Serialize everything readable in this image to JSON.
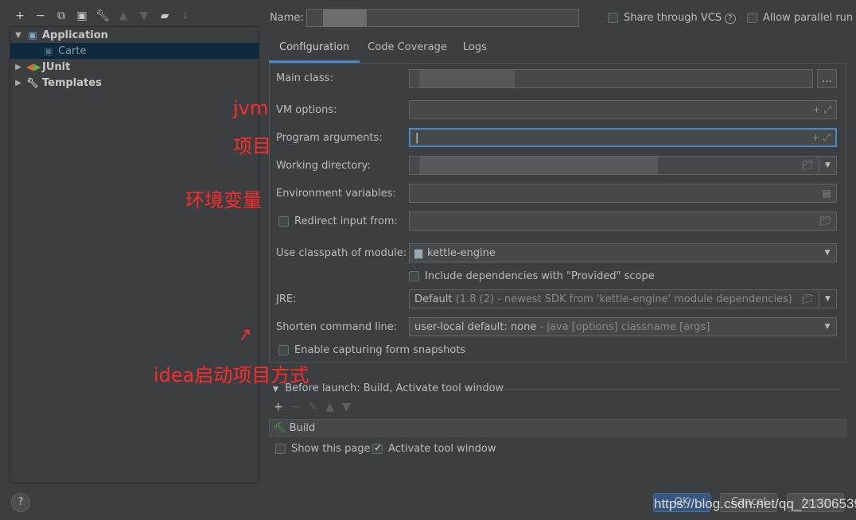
{
  "toolbar": {
    "icons": [
      "plus-icon",
      "minus-icon",
      "copy-icon",
      "save-icon",
      "wrench-icon",
      "arrow-up-icon",
      "arrow-down-icon",
      "folder-add-icon",
      "sort-icon"
    ]
  },
  "tree": {
    "items": [
      {
        "label": "Application",
        "expanded": true
      },
      {
        "label": "Carte",
        "selected": true
      },
      {
        "label": "JUnit"
      },
      {
        "label": "Templates"
      }
    ]
  },
  "header": {
    "name_label": "Name:",
    "name_value": "",
    "share_vcs": "Share through VCS",
    "parallel": "Allow parallel run"
  },
  "tabs": [
    {
      "label": "Configuration",
      "active": true
    },
    {
      "label": "Code Coverage"
    },
    {
      "label": "Logs"
    }
  ],
  "form": {
    "main_class": "Main class:",
    "vm_options": "VM options:",
    "program_args": "Program arguments:",
    "working_dir": "Working directory:",
    "env_vars": "Environment variables:",
    "redirect": "Redirect input from:",
    "classpath": "Use classpath of module:",
    "classpath_value": "kettle-engine",
    "include_deps": "Include dependencies with \"Provided\" scope",
    "jre": "JRE:",
    "jre_value": "Default",
    "jre_hint": "(1.8 (2) - newest SDK from 'kettle-engine' module dependencies)",
    "shorten": "Shorten command line:",
    "shorten_value": "user-local default: none",
    "shorten_hint": "- java [options] classname [args]",
    "snapshots": "Enable capturing form snapshots",
    "browse": "..."
  },
  "before_launch": {
    "title": "Before launch: Build, Activate tool window",
    "item": "Build",
    "show_page": "Show this page",
    "activate": "Activate tool window"
  },
  "annotations": {
    "jvm": "jvm",
    "project": "项目",
    "env": "环境变量",
    "idea": "idea启动项目方式"
  },
  "buttons": {
    "ok": "OK",
    "cancel": "Cancel",
    "apply": "Apply"
  },
  "watermark": "https://blog.csdn.net/qq_21306539",
  "colors": {
    "accent": "#4a88c7",
    "selection": "#0d293e",
    "annotation": "#ff2a2a"
  }
}
